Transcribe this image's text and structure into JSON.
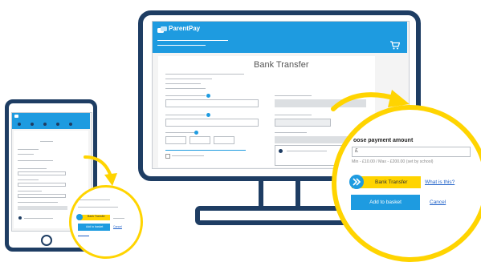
{
  "brand": {
    "logo_text": "ParentPay",
    "primary_color": "#1e9be0",
    "frame_color": "#1e3d63",
    "highlight_color": "#ffd400"
  },
  "desktop": {
    "page_title": "Bank Transfer",
    "cart_icon": "basket-icon"
  },
  "zoom_panel": {
    "heading": "oose payment amount",
    "currency_symbol": "£",
    "amount_value": "",
    "hint": "Min - £10.00 / Max - £200.00 (set by school)",
    "method_button_label": "Bank Transfer",
    "method_icon": "double-chevron-right-icon",
    "what_is_this_link": "What is this?",
    "add_to_basket_label": "Add to basket",
    "cancel_link": "Cancel"
  },
  "phone_zoom": {
    "method_button_label": "Bank Transfer",
    "add_to_basket_label": "Add to basket",
    "cancel_link": "Cancel"
  }
}
